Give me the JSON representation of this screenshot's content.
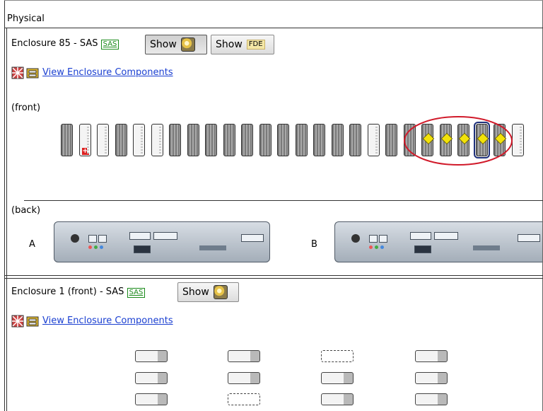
{
  "panel": {
    "title": "Physical"
  },
  "enclosure85": {
    "title": "Enclosure 85 - SAS",
    "sas_tag": "SAS",
    "show_label": "Show",
    "show_fde_label": "Show",
    "fde_tag": "FDE",
    "view_components": "View Enclosure Components",
    "front_label": "(front)",
    "back_label": "(back)",
    "controller_a": "A",
    "controller_b": "B",
    "drives": [
      {
        "type": "dark"
      },
      {
        "type": "light",
        "status": "fault"
      },
      {
        "type": "light"
      },
      {
        "type": "dark"
      },
      {
        "type": "light"
      },
      {
        "type": "light"
      },
      {
        "type": "dark"
      },
      {
        "type": "dark"
      },
      {
        "type": "dark"
      },
      {
        "type": "dark"
      },
      {
        "type": "dark"
      },
      {
        "type": "dark"
      },
      {
        "type": "dark"
      },
      {
        "type": "dark"
      },
      {
        "type": "dark"
      },
      {
        "type": "dark"
      },
      {
        "type": "dark"
      },
      {
        "type": "light"
      },
      {
        "type": "dark"
      },
      {
        "type": "dark"
      },
      {
        "type": "dark",
        "status": "fde"
      },
      {
        "type": "dark",
        "status": "fde"
      },
      {
        "type": "dark",
        "status": "fde"
      },
      {
        "type": "dark",
        "status": "fde",
        "selected": true
      },
      {
        "type": "dark",
        "status": "fde"
      },
      {
        "type": "light"
      }
    ]
  },
  "enclosure1": {
    "title": "Enclosure 1 (front) - SAS",
    "sas_tag": "SAS",
    "show_label": "Show",
    "view_components": "View Enclosure Components",
    "drive_rows": [
      [
        "filled",
        "filled",
        "empty",
        "filled"
      ],
      [
        "filled",
        "filled",
        "filled",
        "filled"
      ],
      [
        "filled",
        "empty",
        "filled",
        "filled"
      ]
    ]
  },
  "colors": {
    "link": "#1a3fd1",
    "highlight_ring": "#d11a2a",
    "sas_tag": "#1a8a1a"
  }
}
